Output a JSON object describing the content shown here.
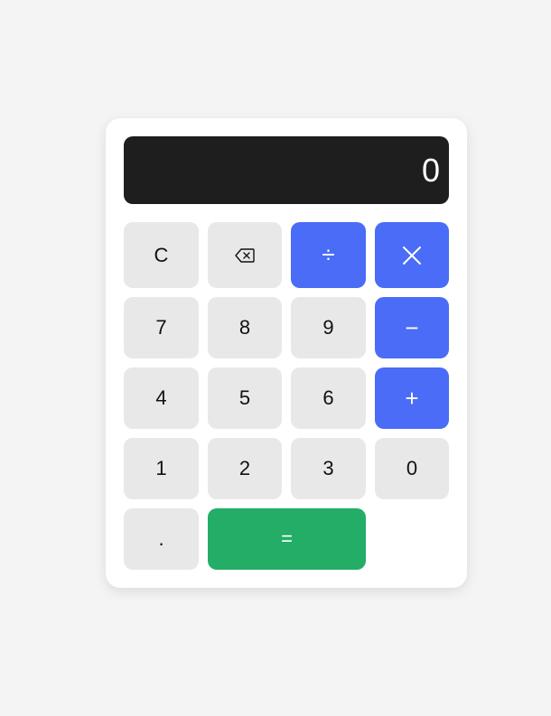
{
  "display": {
    "value": "0"
  },
  "keys": {
    "clear": "C",
    "backspace": "backspace-icon",
    "divide": "÷",
    "multiply": "multiply-icon",
    "seven": "7",
    "eight": "8",
    "nine": "9",
    "minus": "−",
    "four": "4",
    "five": "5",
    "six": "6",
    "plus": "+",
    "one": "1",
    "two": "2",
    "three": "3",
    "zero": "0",
    "decimal": ".",
    "equals": "="
  },
  "colors": {
    "operator": "#4a6cf7",
    "equals": "#23ad67",
    "display_bg": "#1e1e1e",
    "key_bg": "#e8e8e8"
  }
}
